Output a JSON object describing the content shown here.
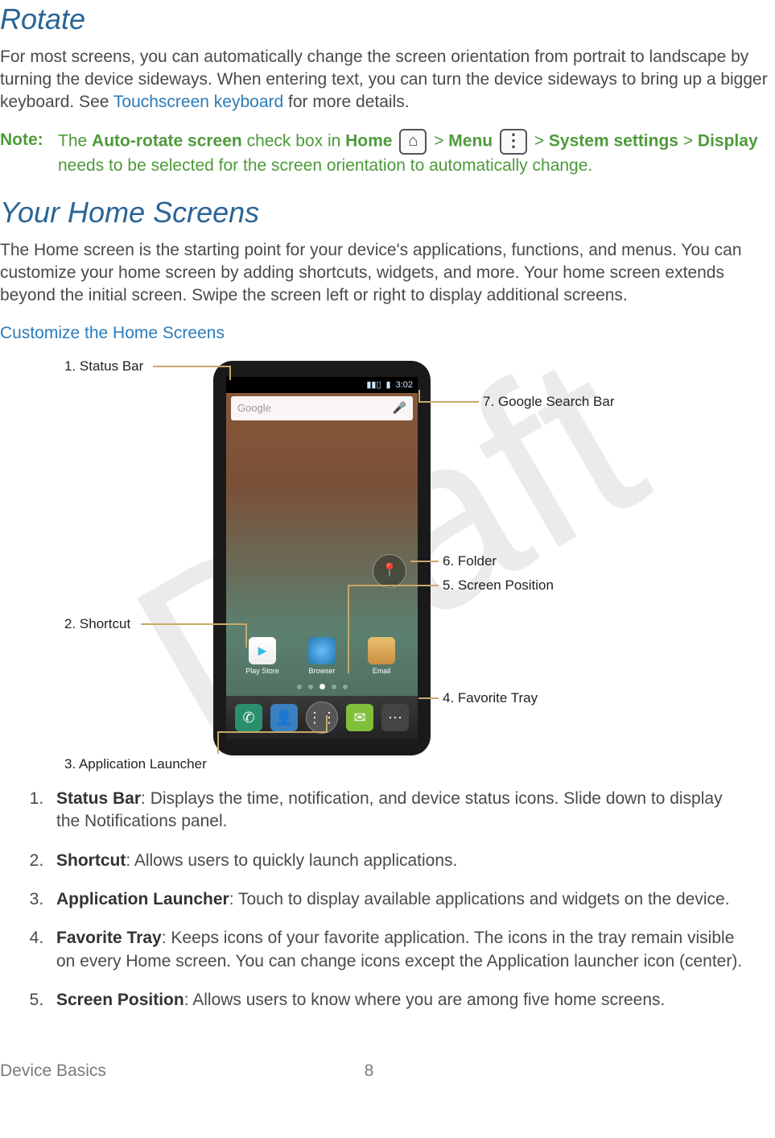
{
  "section1": {
    "heading": "Rotate",
    "body_pre": "For most screens, you can automatically change the screen orientation from portrait to landscape by turning the device sideways. When entering text, you can turn the device sideways to bring up a bigger keyboard. See ",
    "body_link": "Touchscreen keyboard",
    "body_post": " for more details."
  },
  "note": {
    "label": "Note:",
    "t1": "The ",
    "b1": "Auto-rotate screen",
    "t2": " check box in ",
    "b2": "Home",
    "gt": " > ",
    "b3": "Menu",
    "b4": "System settings",
    "b5": "Display",
    "t3": " needs to be selected for the screen orientation to automatically change."
  },
  "section2": {
    "heading": "Your Home Screens",
    "body": "The Home screen is the starting point for your device's applications, functions, and menus. You can customize your home screen by adding shortcuts, widgets, and more. Your home screen extends beyond the initial screen. Swipe the screen left or right to display additional screens.",
    "sublink": "Customize the Home Screens"
  },
  "figure": {
    "c1": "1. Status Bar",
    "c2": "2. Shortcut",
    "c3": "3. Application Launcher",
    "c4": "4. Favorite Tray",
    "c5": "5. Screen Position",
    "c6": "6. Folder",
    "c7": "7. Google Search Bar",
    "phone": {
      "time": "3:02",
      "search": "Google",
      "sc1": "Play Store",
      "sc2": "Browser",
      "sc3": "Email"
    }
  },
  "list": {
    "i1": {
      "b": "Status Bar",
      "t": ": Displays the time, notification, and device status icons. Slide down to display the Notifications panel."
    },
    "i2": {
      "b": "Shortcut",
      "t": ": Allows users to quickly launch applications."
    },
    "i3": {
      "b": "Application Launcher",
      "t": ": Touch to display available applications and widgets on the device."
    },
    "i4": {
      "b": "Favorite Tray",
      "t": ": Keeps icons of your favorite application. The icons in the tray remain visible on every Home screen. You can change icons except the Application launcher icon (center)."
    },
    "i5": {
      "b": "Screen Position",
      "t": ": Allows users to know where you are among five home screens."
    }
  },
  "footer": {
    "chapter": "Device Basics",
    "page": "8"
  }
}
